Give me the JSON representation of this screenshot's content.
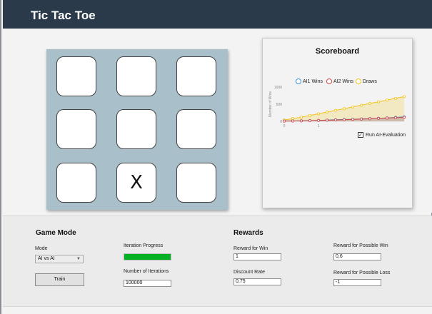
{
  "window": {
    "title": "Tic Tac Toe"
  },
  "board": {
    "cells": [
      "",
      "",
      "",
      "",
      "",
      "",
      "",
      "X",
      ""
    ]
  },
  "scoreboard": {
    "title": "Scoreboard",
    "run_eval_label": "Run AI-Evaluation",
    "run_eval_checked": true
  },
  "chart_data": {
    "type": "line",
    "ylabel": "Number of Wins",
    "ylim": [
      0,
      1000
    ],
    "yticks": [
      "0",
      "500",
      "1000"
    ],
    "xticks": [
      "0",
      "1"
    ],
    "legend_placement": "top",
    "series": [
      {
        "name": "AI1 Wins",
        "color": "#3a8fd1",
        "values": [
          10,
          12,
          15,
          20,
          25,
          35,
          45,
          55,
          60,
          70,
          80,
          90,
          100,
          115,
          130
        ]
      },
      {
        "name": "AI2 Wins",
        "color": "#d64545",
        "values": [
          5,
          8,
          12,
          18,
          25,
          32,
          40,
          48,
          55,
          65,
          75,
          85,
          95,
          105,
          115
        ]
      },
      {
        "name": "Draws",
        "color": "#f0c419",
        "values": [
          40,
          80,
          120,
          170,
          220,
          270,
          320,
          370,
          420,
          470,
          520,
          570,
          620,
          670,
          720
        ]
      }
    ]
  },
  "game_mode": {
    "heading": "Game Mode",
    "mode_label": "Mode",
    "mode_value": "AI vs AI",
    "train_label": "Train",
    "progress_label": "Iteration Progress",
    "progress_fraction": 1.0,
    "progress_color": "#06b025",
    "iterations_label": "Number of Iterations",
    "iterations_value": "100000"
  },
  "rewards": {
    "heading": "Rewards",
    "win_label": "Reward for Win",
    "win_value": "1",
    "discount_label": "Discount Rate",
    "discount_value": "0,75",
    "possible_win_label": "Reward for Possible Win",
    "possible_win_value": "0,6",
    "possible_loss_label": "Reward for Possible Loss",
    "possible_loss_value": "-1"
  }
}
